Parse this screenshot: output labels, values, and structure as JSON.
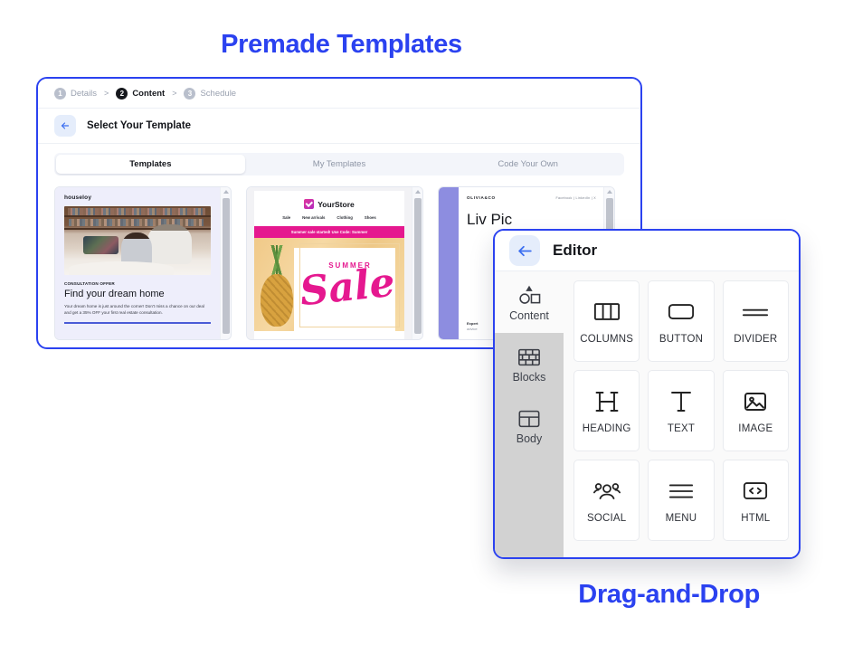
{
  "headlines": {
    "top": "Premade Templates",
    "bottom": "Drag-and-Drop"
  },
  "accent_color": "#2b42f0",
  "templates_window": {
    "breadcrumb": [
      {
        "num": "1",
        "label": "Details",
        "active": false
      },
      {
        "num": "2",
        "label": "Content",
        "active": true
      },
      {
        "num": "3",
        "label": "Schedule",
        "active": false
      }
    ],
    "separator": ">",
    "back_icon": "arrow-left-icon",
    "title": "Select Your Template",
    "tabs": [
      {
        "label": "Templates",
        "active": true
      },
      {
        "label": "My Templates",
        "active": false
      },
      {
        "label": "Code Your Own",
        "active": false
      }
    ],
    "cards": [
      {
        "id": "houseloy",
        "logo": "houseloy",
        "eyebrow": "CONSULTATION OFFER",
        "heading": "Find your dream home",
        "body": "Your dream home is just around the corner! Don't miss a chance on our deal and get a 35% OFF your first real estate consultation."
      },
      {
        "id": "yourstore",
        "brand": "YourStore",
        "nav": [
          "Sale",
          "New arrivals",
          "Clothing",
          "Shoes"
        ],
        "banner": "Summer sale started! Use Code: Summer",
        "hero_kicker": "SUMMER",
        "hero_word": "Sale"
      },
      {
        "id": "oliviaandco",
        "logo": "OLIVIA&CO",
        "links": "Facebook  |  LinkedIn  |  X",
        "heading": "Liv\nPic",
        "footnote": "Expert",
        "footnote_sub": "advice"
      }
    ]
  },
  "editor_window": {
    "back_icon": "arrow-left-icon",
    "title": "Editor",
    "rail": [
      {
        "label": "Content",
        "icon": "shapes-icon",
        "active": true
      },
      {
        "label": "Blocks",
        "icon": "bricks-icon",
        "active": false
      },
      {
        "label": "Body",
        "icon": "layout-icon",
        "active": false
      }
    ],
    "blocks": [
      {
        "label": "COLUMNS",
        "icon": "columns-icon"
      },
      {
        "label": "BUTTON",
        "icon": "button-icon"
      },
      {
        "label": "DIVIDER",
        "icon": "divider-icon"
      },
      {
        "label": "HEADING",
        "icon": "heading-icon"
      },
      {
        "label": "TEXT",
        "icon": "text-icon"
      },
      {
        "label": "IMAGE",
        "icon": "image-icon"
      },
      {
        "label": "SOCIAL",
        "icon": "social-icon"
      },
      {
        "label": "MENU",
        "icon": "menu-icon"
      },
      {
        "label": "HTML",
        "icon": "code-icon"
      }
    ]
  }
}
